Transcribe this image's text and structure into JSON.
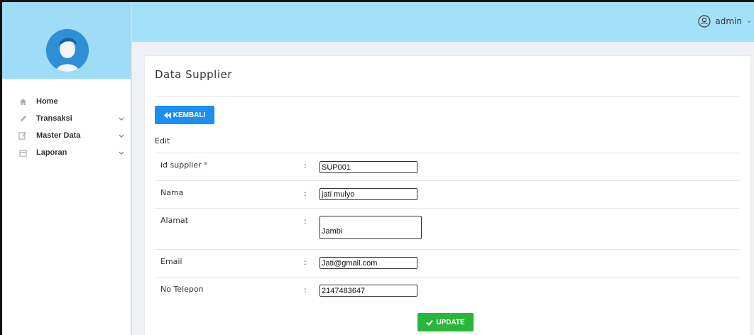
{
  "header": {
    "user_label": "admin",
    "user_icon": "user-circle-icon",
    "chevron_icon": "chevron-down-icon",
    "bg_color": "#a3e1fa"
  },
  "sidebar": {
    "avatar_icon": "user-avatar-icon",
    "head_color": "#9fdcf8",
    "items": [
      {
        "label": "Home",
        "icon": "home-icon",
        "has_submenu": false
      },
      {
        "label": "Transaksi",
        "icon": "pencil-icon",
        "has_submenu": true
      },
      {
        "label": "Master Data",
        "icon": "edit-icon",
        "has_submenu": true
      },
      {
        "label": "Laporan",
        "icon": "calendar-icon",
        "has_submenu": true
      }
    ]
  },
  "page": {
    "title": "Data Supplier",
    "back_button": "KEMBALI",
    "back_icon": "double-chevron-left-icon",
    "section_label": "Edit",
    "update_button": "UPDATE",
    "update_icon": "check-icon",
    "accent_color": "#1b8ef0",
    "success_color": "#29b739"
  },
  "form": {
    "separator": ":",
    "required_marker": "*",
    "fields": [
      {
        "label": "id supplier",
        "required": true,
        "value": "SUP001"
      },
      {
        "label": "Nama",
        "required": false,
        "value": "jati mulyo"
      },
      {
        "label": "Alamat",
        "required": false,
        "value": "Jambi"
      },
      {
        "label": "Email",
        "required": false,
        "value": "Jati@gmail.com"
      },
      {
        "label": "No Telepon",
        "required": false,
        "value": "2147483647"
      }
    ]
  }
}
